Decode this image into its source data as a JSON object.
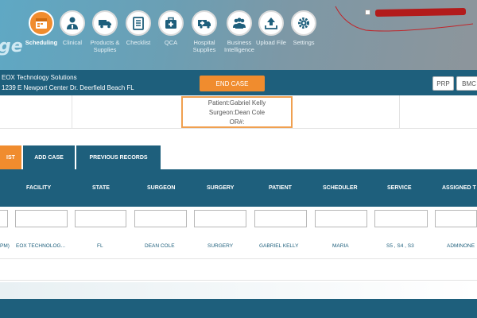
{
  "header": {
    "logo_text": "ge",
    "nav": [
      {
        "label": "Scheduling",
        "icon": "calendar-icon",
        "active": true
      },
      {
        "label": "Clinical",
        "icon": "doctor-icon"
      },
      {
        "label": "Products & Supplies",
        "icon": "truck-icon"
      },
      {
        "label": "Checklist",
        "icon": "checklist-icon"
      },
      {
        "label": "QCA",
        "icon": "medical-kit-icon"
      },
      {
        "label": "Hospital Supplies",
        "icon": "ambulance-icon"
      },
      {
        "label": "Business Intelligence",
        "icon": "people-icon"
      },
      {
        "label": "Upload File",
        "icon": "upload-icon"
      },
      {
        "label": "Settings",
        "icon": "gear-icon"
      }
    ]
  },
  "company": {
    "name": "EOX Technology Solutions",
    "address": "1239 E Newport Center Dr.  Deerfield Beach FL",
    "end_case_label": "END CASE",
    "buttons": [
      "PRP",
      "BMC"
    ]
  },
  "case_info": {
    "patient_label": "Patient:",
    "patient": "Gabriel Kelly",
    "surgeon_label": "Surgeon:",
    "surgeon": "Dean Cole",
    "or_label": "OR#:",
    "or_value": ""
  },
  "tabs": [
    {
      "label": "IST",
      "active": true
    },
    {
      "label": "ADD CASE",
      "active": false
    },
    {
      "label": "PREVIOUS RECORDS",
      "active": false
    }
  ],
  "table": {
    "columns": [
      "FACILITY",
      "STATE",
      "SURGEON",
      "SURGERY",
      "PATIENT",
      "SCHEDULER",
      "SERVICE",
      "ASSIGNED T"
    ],
    "rows": [
      {
        "time": "PM)",
        "cells": [
          "EOX TECHNOLOG...",
          "FL",
          "DEAN COLE",
          "SURGERY",
          "GABRIEL KELLY",
          "MARIA",
          "S5 , S4 , S3",
          "ADMINONE"
        ]
      }
    ]
  },
  "colors": {
    "primary": "#1e5f7c",
    "accent": "#f08c2e"
  }
}
